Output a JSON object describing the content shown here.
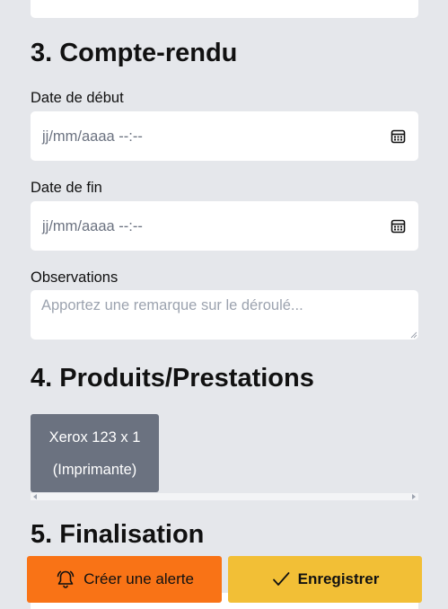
{
  "sections": {
    "report": {
      "title": "3. Compte-rendu",
      "start_date": {
        "label": "Date de début",
        "placeholder": "jj/mm/aaaa --:--"
      },
      "end_date": {
        "label": "Date de fin",
        "placeholder": "jj/mm/aaaa --:--"
      },
      "observations": {
        "label": "Observations",
        "placeholder": "Apportez une remarque sur le déroulé..."
      }
    },
    "products": {
      "title": "4. Produits/Prestations",
      "items": [
        {
          "name": "Xerox 123 x 1",
          "category": "(Imprimante)"
        }
      ]
    },
    "finalisation": {
      "title": "5. Finalisation"
    }
  },
  "actions": {
    "alert_label": "Créer une alerte",
    "save_label": "Enregistrer"
  },
  "icons": {
    "calendar": "calendar-icon",
    "bell": "bell-icon",
    "check": "check-icon"
  },
  "colors": {
    "background": "#e5e7eb",
    "alert_button": "#f97316",
    "save_button": "#f2bf36",
    "product_tile": "#6b7280"
  }
}
